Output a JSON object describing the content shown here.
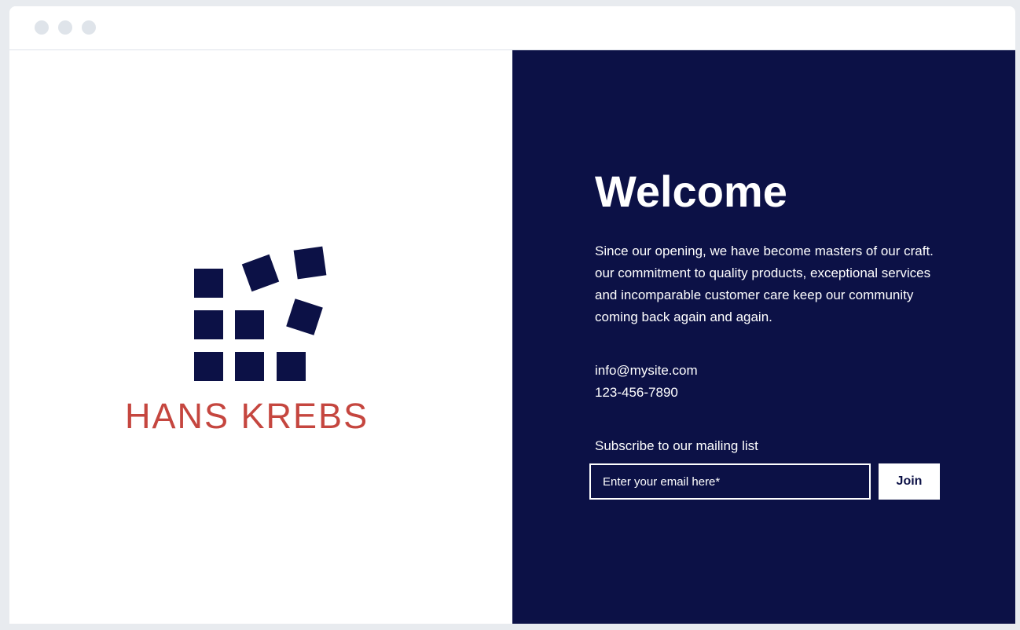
{
  "brand": {
    "name": "HANS KREBS",
    "mark_color": "#0c1146",
    "text_color": "#c5463f"
  },
  "hero": {
    "title": "Welcome",
    "intro": "Since our opening, we have become masters of our craft. our commitment to quality products, exceptional services and incomparable customer care keep our community coming back again and again.",
    "background_color": "#0c1146"
  },
  "contact": {
    "email": "info@mysite.com",
    "phone": "123-456-7890"
  },
  "subscribe": {
    "label": "Subscribe to our mailing list",
    "email_placeholder": "Enter your email here*",
    "email_value": "",
    "button_label": "Join"
  }
}
